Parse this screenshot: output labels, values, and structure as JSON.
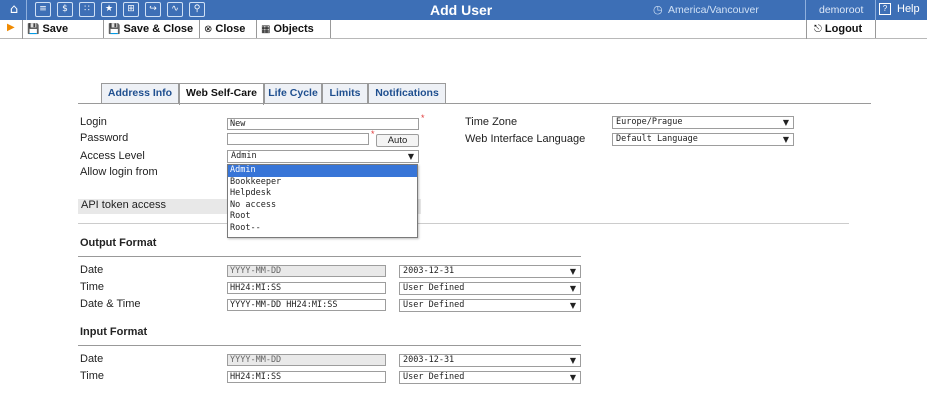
{
  "topbar": {
    "title": "Add User",
    "timezone": "America/Vancouver",
    "user": "demoroot",
    "help": "Help",
    "icons": [
      "home-icon",
      "list-icon",
      "dollar-icon",
      "grid-icon",
      "person-icon",
      "network-icon",
      "export-icon",
      "chart-icon",
      "search-icon"
    ]
  },
  "toolbar": {
    "save": "Save",
    "save_close": "Save & Close",
    "close": "Close",
    "objects": "Objects",
    "logout": "Logout"
  },
  "tabs": [
    "Address Info",
    "Web Self-Care",
    "Life Cycle",
    "Limits",
    "Notifications"
  ],
  "active_tab": "Web Self-Care",
  "form": {
    "login_label": "Login",
    "login_value": "New",
    "password_label": "Password",
    "password_value": "",
    "auto_label": "Auto",
    "access_label": "Access Level",
    "access_value": "Admin",
    "allow_label": "Allow login from",
    "api_label": "API token access",
    "timezone_label": "Time Zone",
    "timezone_value": "Europe/Prague",
    "language_label": "Web Interface Language",
    "language_value": "Default Language"
  },
  "access_options": [
    "Admin",
    "Bookkeeper",
    "Helpdesk",
    "No access",
    "Root",
    "Root--"
  ],
  "output_format": {
    "title": "Output Format",
    "date_label": "Date",
    "date_value": "YYYY-MM-DD",
    "date_select": "2003-12-31",
    "time_label": "Time",
    "time_value": "HH24:MI:SS",
    "time_select": "User Defined",
    "datetime_label": "Date & Time",
    "datetime_value": "YYYY-MM-DD HH24:MI:SS",
    "datetime_select": "User Defined"
  },
  "input_format": {
    "title": "Input Format",
    "date_label": "Date",
    "date_value": "YYYY-MM-DD",
    "date_select": "2003-12-31",
    "time_label": "Time",
    "time_value": "HH24:MI:SS",
    "time_select": "User Defined"
  },
  "colors": {
    "topbar": "#3d6fb6",
    "accent": "#1f4f8f",
    "selected_option": "#3875d7",
    "required": "#e03b3b"
  }
}
